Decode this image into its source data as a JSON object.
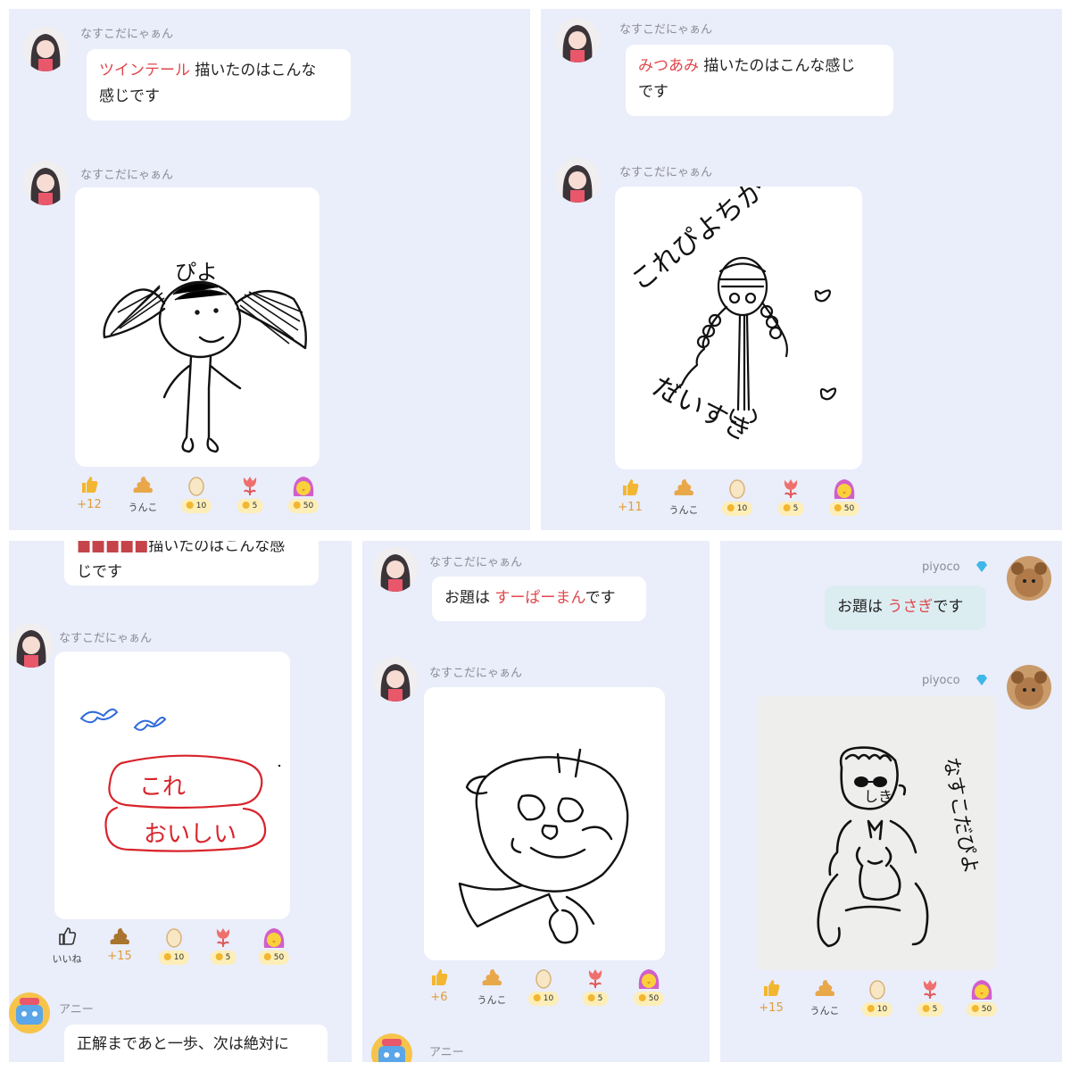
{
  "panel1": {
    "sender": "なすこだにゃぁん",
    "message": {
      "highlight": "ツインテール",
      "text_line1": " 描いたのはこんな",
      "text_line2": "感じです"
    },
    "drawing_text": "ぴよ",
    "reactions": {
      "like_count": "+12",
      "poop_label": "うんこ",
      "egg_cost": "10",
      "tulip_cost": "5",
      "chick_cost": "50"
    }
  },
  "panel2": {
    "sender": "なすこだにゃぁん",
    "message": {
      "highlight": "みつあみ",
      "text_line1": " 描いたのはこんな感じ",
      "text_line2": "です"
    },
    "drawing_text_1": "これぴよちか",
    "drawing_text_2": "だいすき",
    "reactions": {
      "like_count": "+11",
      "poop_label": "うんこ",
      "egg_cost": "10",
      "tulip_cost": "5",
      "chick_cost": "50"
    }
  },
  "panel3": {
    "sender": "なすこだにゃぁん",
    "message": {
      "text_line1": "描いたのはこんな感",
      "text_line2": "じです"
    },
    "drawing_text_1": "これ",
    "drawing_text_2": "おいしい",
    "reactions": {
      "like_label": "いいね",
      "poop_count": "+15",
      "egg_cost": "10",
      "tulip_cost": "5",
      "chick_cost": "50"
    },
    "next_sender": "アニー",
    "next_message": "正解まであと一歩、次は絶対に"
  },
  "panel4": {
    "sender": "なすこだにゃぁん",
    "message": {
      "prefix": "お題は ",
      "highlight": "すーぱーまん",
      "suffix": "です"
    },
    "reactions": {
      "like_count": "+6",
      "poop_label": "うんこ",
      "egg_cost": "10",
      "tulip_cost": "5",
      "chick_cost": "50"
    },
    "next_sender": "アニー"
  },
  "panel5": {
    "sender": "piyoco",
    "message": {
      "prefix": "お題は ",
      "highlight": "うさぎ",
      "suffix": "です"
    },
    "drawing_text_1": "しき",
    "drawing_text_2": "なすこだぴよ",
    "reactions": {
      "like_count": "+15",
      "poop_label": "うんこ",
      "egg_cost": "10",
      "tulip_cost": "5",
      "chick_cost": "50"
    }
  },
  "colors": {
    "panel_bg": "#eaedfa",
    "highlight": "#e0474c",
    "count": "#e09d3a",
    "coin_bg": "#fdeeb7"
  }
}
